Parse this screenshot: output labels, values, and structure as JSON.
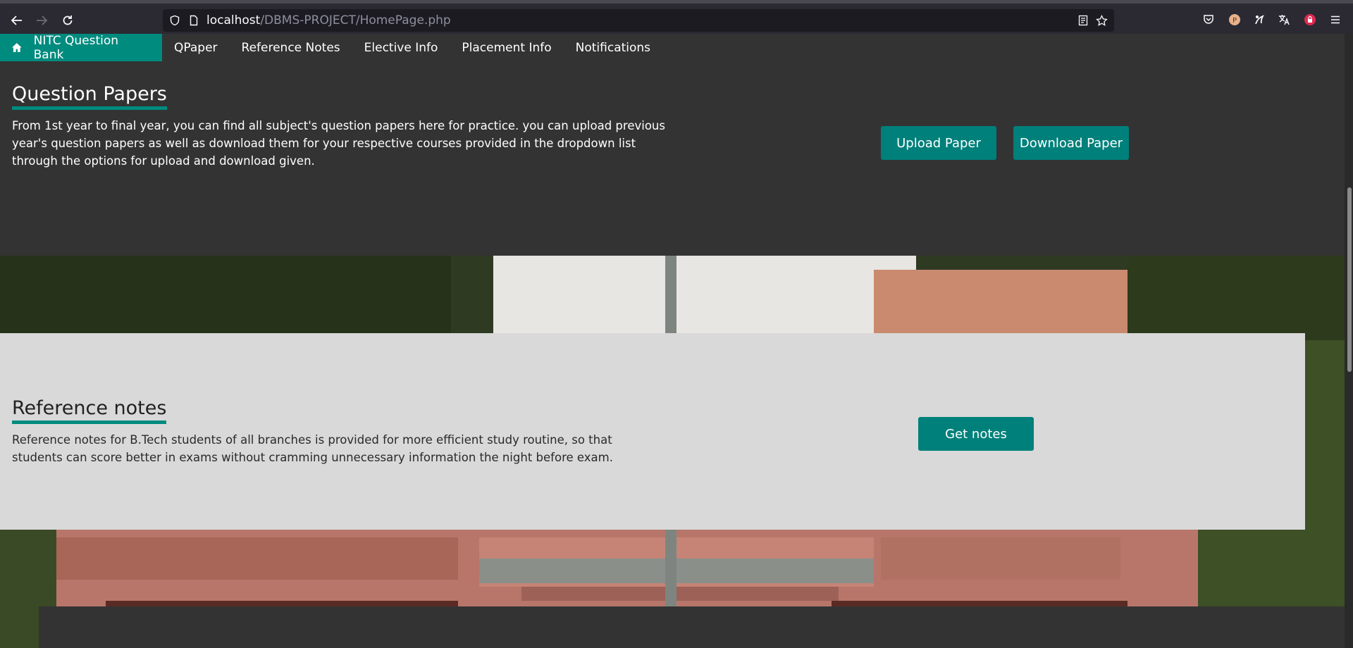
{
  "browser": {
    "url_host": "localhost",
    "url_path": "/DBMS-PROJECT/HomePage.php"
  },
  "navbar": {
    "brand": "NITC Question Bank",
    "links": [
      "QPaper",
      "Reference Notes",
      "Elective Info",
      "Placement Info",
      "Notifications"
    ]
  },
  "question_papers": {
    "title": "Question Papers",
    "description": "From 1st year to final year, you can find all subject's question papers here for practice. you can upload previous year's question papers as well as download them for your respective courses provided in the dropdown list through the options for upload and download given.",
    "upload_label": "Upload Paper",
    "download_label": "Download Paper"
  },
  "reference_notes": {
    "title": "Reference notes",
    "description": "Reference notes for B.Tech students of all branches is provided for more efficient study routine, so that students can score better in exams without cramming unnecessary information the night before exam.",
    "button_label": "Get notes"
  },
  "colors": {
    "accent": "#008b7f",
    "button": "#00807a",
    "dark_section": "#333333",
    "light_section": "#d9d9d9"
  }
}
